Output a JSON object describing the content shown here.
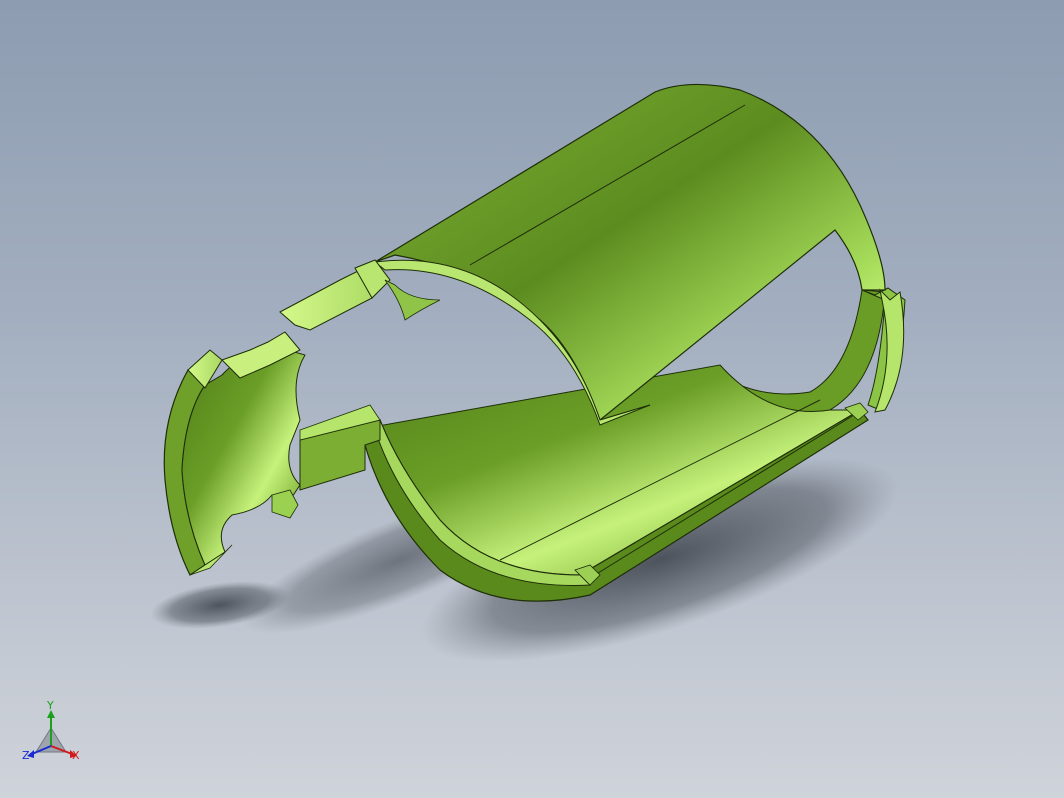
{
  "viewport": {
    "background_top": "#8d9cb1",
    "background_bottom": "#cfd3da"
  },
  "model": {
    "color_base": "#5c8c1f",
    "color_highlight": "#d8ff88",
    "color_shadow": "#3f6a12"
  },
  "triad": {
    "x_label": "X",
    "y_label": "Y",
    "z_label": "Z",
    "x_color": "#d01a1a",
    "y_color": "#1aa01a",
    "z_color": "#1a2bd0"
  }
}
